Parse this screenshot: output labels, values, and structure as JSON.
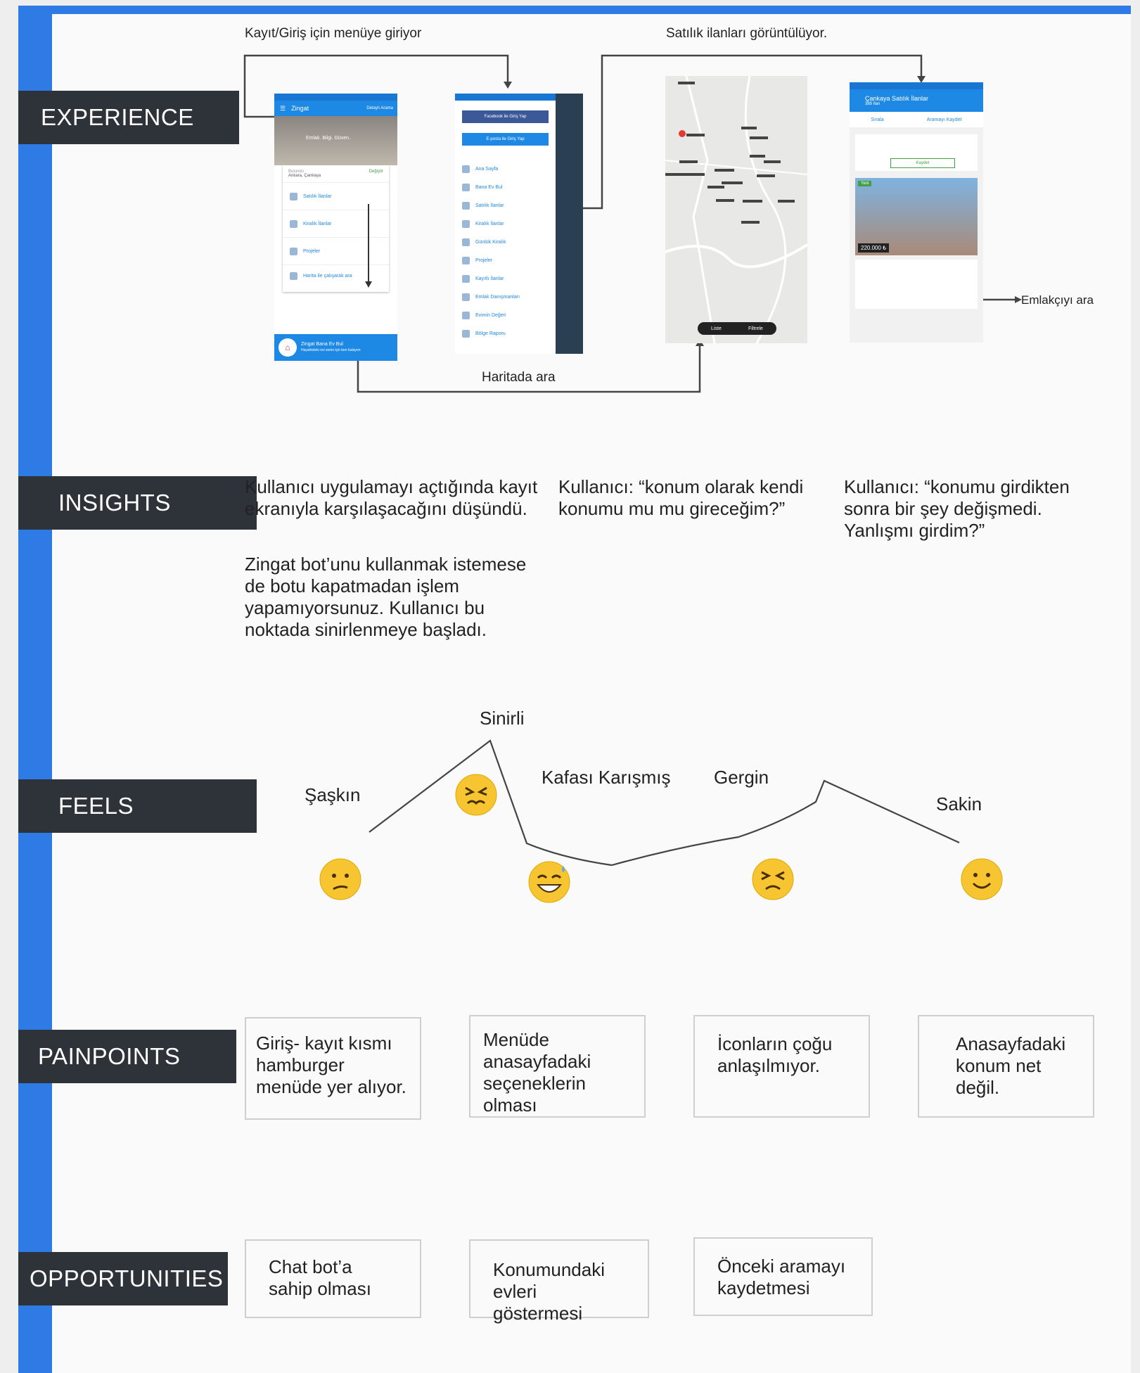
{
  "sections": {
    "experience": "EXPERIENCE",
    "insights": "INSIGHTS",
    "feels": "FEELS",
    "painpoints": "PAINPOINTS",
    "opportunities": "OPPORTUNITIES"
  },
  "experience": {
    "note_menu": "Kayıt/Giriş için menüye giriyor",
    "note_listings": "Satılık ilanları görüntülüyor.",
    "note_map": "Haritada ara",
    "note_agent": "Emlakçıyı ara",
    "screens": {
      "home": {
        "app_name": "Zingat",
        "header_right": "Detaylı Arama",
        "hero_text": "Emlak. Bilgi. Güven.",
        "location_label": "Bulundu",
        "location_value": "Ankara, Çankaya",
        "change": "Değiştir",
        "items": [
          "Satılık İlanlar",
          "Kiralık İlanlar",
          "Projeler",
          "Harita ile çalışarak ara"
        ],
        "bot_title": "Zingat Bana Ev Bul",
        "bot_sub": "Hayalindeki evi senin için ben bulayım"
      },
      "menu": {
        "facebook": "Facebook ile Giriş Yap",
        "email": "E-posta ile Giriş Yap",
        "items": [
          "Ana Sayfa",
          "Bana Ev Bul",
          "Satılık İlanlar",
          "Kiralık İlanlar",
          "Günlük Kiralık",
          "Projeler",
          "Kayıtlı İlanlar",
          "Emlak Danışmanları",
          "Evimin Değeri",
          "Bölge Raporu"
        ]
      },
      "map": {
        "list_btn": "Liste",
        "filter_btn": "Filtrele"
      },
      "listing": {
        "title": "Çankaya Satılık İlanlar",
        "subtitle": "389 İlan",
        "sort": "Sırala",
        "save": "Aramayı Kaydet",
        "badge": "Yeni",
        "price": "220.000 ₺",
        "btn": "Kaydet"
      }
    }
  },
  "insights": {
    "col1_p1": "Kullanıcı uygulamayı açtığında kayıt ekranıyla karşılaşacağını düşündü.",
    "col1_p2": "Zingat bot’unu kullanmak istemese de botu kapatmadan işlem yapamıyorsunuz. Kullanıcı bu noktada sinirlenmeye başladı.",
    "col2": "Kullanıcı: “konum olarak kendi konumu mu mu gireceğim?”",
    "col3": "Kullanıcı: “konumu girdikten sonra bir şey değişmedi. Yanlışmı girdim?”"
  },
  "feels": {
    "saskin": "Şaşkın",
    "sinirli": "Sinirli",
    "kafasi": "Kafası Karışmış",
    "gergin": "Gergin",
    "sakin": "Sakin"
  },
  "painpoints": [
    "Giriş- kayıt kısmı hamburger menüde yer alıyor.",
    "Menüde anasayfadaki seçeneklerin olması",
    "İconların çoğu anlaşılmıyor.",
    "Anasayfadaki konum net değil."
  ],
  "opportunities": [
    "Chat bot’a sahip olması",
    "Konumundaki evleri göstermesi",
    "Önceki aramayı kaydetmesi"
  ],
  "colors": {
    "accent": "#2f7be6",
    "label_bg": "#2d3338",
    "app_blue": "#1e88e5",
    "emoji_yellow": "#f7c531"
  }
}
